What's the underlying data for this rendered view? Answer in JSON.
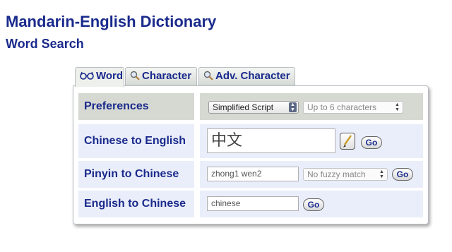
{
  "header": {
    "title": "Mandarin-English Dictionary",
    "subtitle": "Word Search"
  },
  "tabs": [
    {
      "label": "Word",
      "icon": "glasses-icon",
      "active": true
    },
    {
      "label": "Character",
      "icon": "magnifier-icon",
      "active": false
    },
    {
      "label": "Adv. Character",
      "icon": "magnifier-icon",
      "active": false
    }
  ],
  "rows": {
    "preferences": {
      "label": "Preferences",
      "script_select": "Simplified Script",
      "chars_select": "Up to 6 characters"
    },
    "chinese_to_english": {
      "label": "Chinese to English",
      "input_value": "中文",
      "go": "Go"
    },
    "pinyin_to_chinese": {
      "label": "Pinyin to Chinese",
      "input_value": "zhong1 wen2",
      "fuzzy_select": "No fuzzy match",
      "go": "Go"
    },
    "english_to_chinese": {
      "label": "English to Chinese",
      "input_value": "chinese",
      "go": "Go"
    }
  },
  "colors": {
    "heading": "#1a2a8c",
    "row_gray": "#d6d9d2",
    "row_blue": "#eaeefa"
  }
}
